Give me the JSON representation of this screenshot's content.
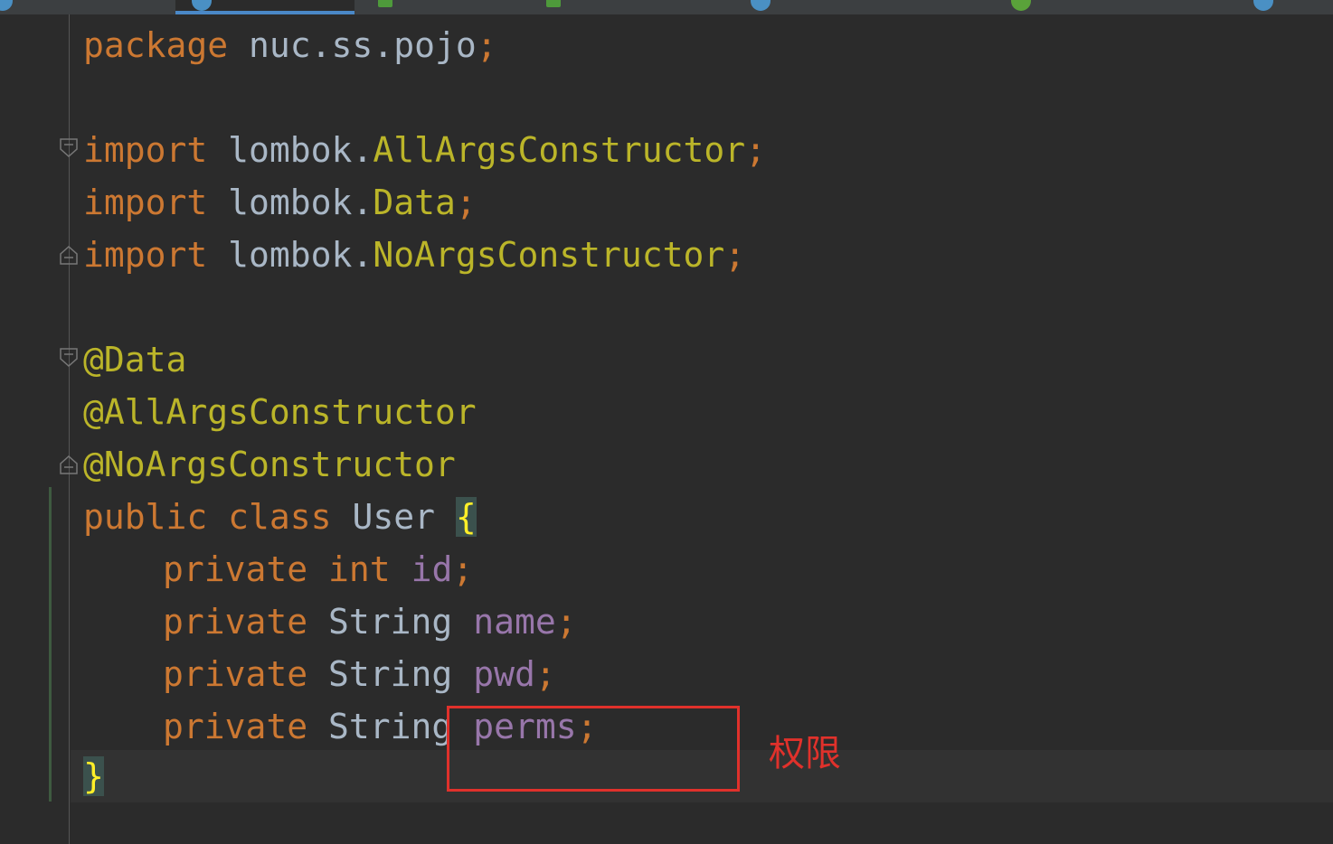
{
  "tabs": [
    {
      "label": "",
      "icon": "class-icon",
      "color": "#4a90c4",
      "active": false
    },
    {
      "label": "",
      "icon": "class-icon",
      "color": "#4a90c4",
      "active": true
    },
    {
      "label": "",
      "icon": "html-file-icon",
      "color": "#4e9a3b",
      "active": false
    },
    {
      "label": "",
      "icon": "html-file-icon",
      "color": "#4e9a3b",
      "active": false
    },
    {
      "label": "",
      "icon": "class-icon",
      "color": "#4a90c4",
      "active": false
    },
    {
      "label": "",
      "icon": "spring-icon",
      "color": "#5aa23a",
      "active": false
    },
    {
      "label": "",
      "icon": "class-icon",
      "color": "#4a90c4",
      "active": false
    }
  ],
  "code": {
    "package_kw": "package",
    "package_name": "nuc.ss.pojo",
    "semicolon": ";",
    "import_kw": "import",
    "lombok_prefix": "lombok.",
    "import1_class": "AllArgsConstructor",
    "import2_class": "Data",
    "import3_class": "NoArgsConstructor",
    "ann1": "@Data",
    "ann2": "@AllArgsConstructor",
    "ann3": "@NoArgsConstructor",
    "public_kw": "public",
    "class_kw": "class",
    "class_name": "User",
    "open_brace": "{",
    "close_brace": "}",
    "private_kw": "private",
    "int_kw": "int",
    "string_type": "String",
    "field1": "id",
    "field2": "name",
    "field3": "pwd",
    "field4": "perms"
  },
  "annotation": {
    "text": "权限",
    "color": "#e0312b"
  },
  "colors": {
    "background": "#2b2b2b",
    "keyword": "#cc7832",
    "annotation": "#bbb529",
    "field": "#9876aa",
    "identifier": "#a9b7c6"
  }
}
